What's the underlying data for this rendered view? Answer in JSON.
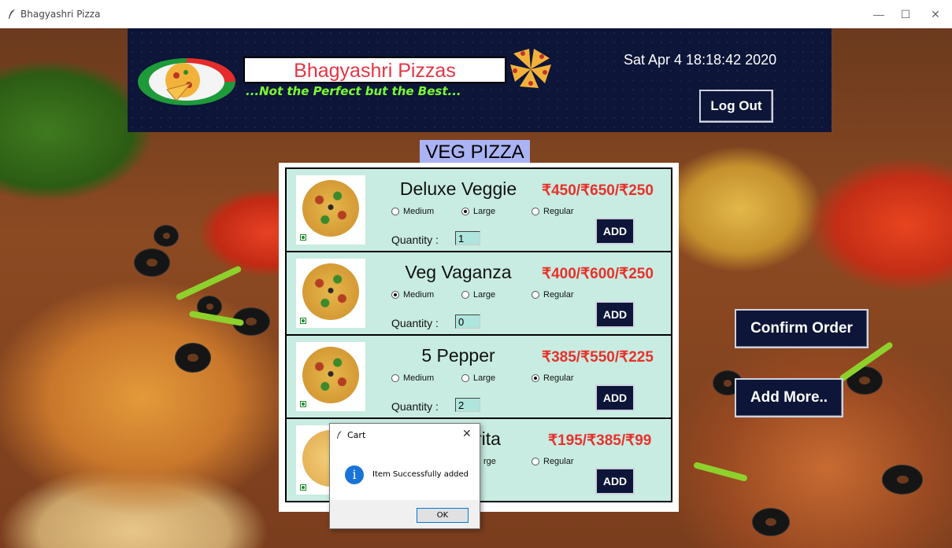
{
  "window": {
    "title": "Bhagyashri Pizza",
    "minimize": "—",
    "maximize": "☐",
    "close": "✕"
  },
  "header": {
    "brand": "Bhagyashri Pizzas",
    "tagline": "...Not the Perfect but the Best...",
    "datetime": "Sat Apr  4 18:18:42 2020",
    "logout_label": "Log Out"
  },
  "section_title": "VEG PIZZA",
  "size_options": [
    "Medium",
    "Large",
    "Regular"
  ],
  "items": [
    {
      "name": "Deluxe Veggie",
      "price": "₹450/₹650/₹250",
      "selected_size": "Large",
      "qty_label": "Quantity :",
      "quantity": "1",
      "add_label": "ADD"
    },
    {
      "name": "Veg Vaganza",
      "price": "₹400/₹600/₹250",
      "selected_size": "Medium",
      "qty_label": "Quantity :",
      "quantity": "0",
      "add_label": "ADD"
    },
    {
      "name": "5 Pepper",
      "price": "₹385/₹550/₹225",
      "selected_size": "Regular",
      "qty_label": "Quantity :",
      "quantity": "2",
      "add_label": "ADD"
    },
    {
      "name": "rita",
      "price": "₹195/₹385/₹99",
      "size_partial": "rge",
      "regular_label": "Regular",
      "add_label": "ADD"
    }
  ],
  "side_buttons": {
    "confirm": "Confirm Order",
    "add_more": "Add More.."
  },
  "dialog": {
    "title": "Cart",
    "close": "✕",
    "icon": "i",
    "message": "Item Successfully added",
    "ok_label": "OK"
  },
  "colors": {
    "header_bg": "#0d1538",
    "brand_text": "#e53545",
    "tagline": "#7aff32",
    "price": "#e8312c",
    "item_bg": "#c8ece1",
    "section_title_bg": "#aab3f3"
  }
}
